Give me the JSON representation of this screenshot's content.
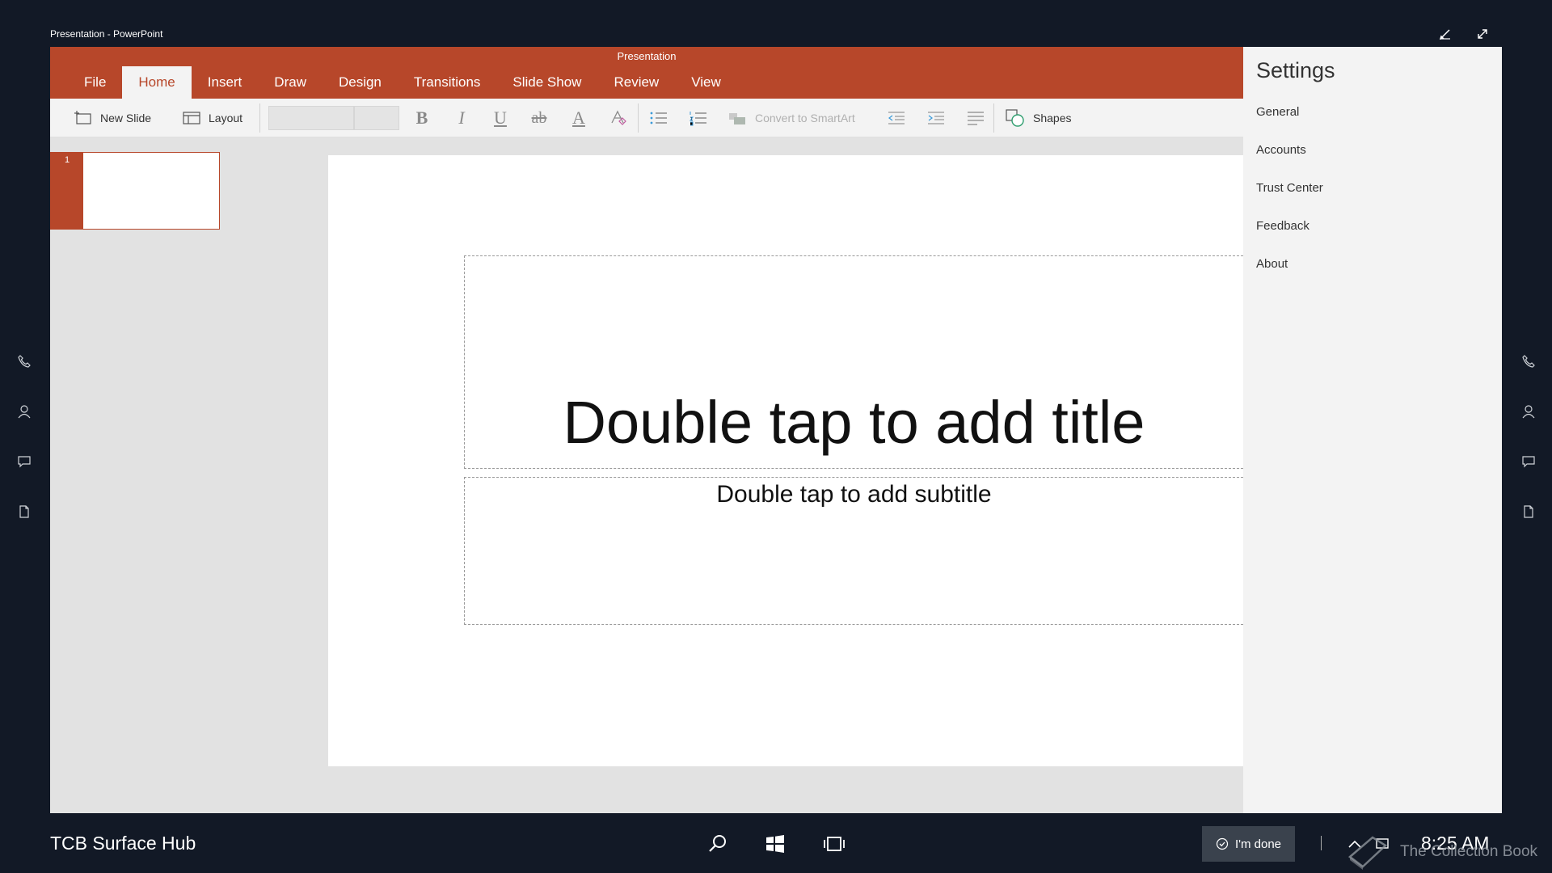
{
  "window": {
    "title": "Presentation - PowerPoint"
  },
  "app": {
    "doc_title": "Presentation",
    "tabs": [
      "File",
      "Home",
      "Insert",
      "Draw",
      "Design",
      "Transitions",
      "Slide Show",
      "Review",
      "View"
    ],
    "active_tab": "Home",
    "toolbar": {
      "new_slide": "New Slide",
      "layout": "Layout",
      "font_name": "",
      "font_size": "",
      "bold": "B",
      "italic": "I",
      "underline": "U",
      "strikethrough": "ab",
      "font_color": "A",
      "convert_smartart": "Convert to SmartArt",
      "shapes": "Shapes"
    },
    "thumbnails": [
      {
        "number": "1"
      }
    ],
    "slide": {
      "title_placeholder": "Double tap to add title",
      "subtitle_placeholder": "Double tap to add subtitle"
    }
  },
  "settings": {
    "title": "Settings",
    "items": [
      "General",
      "Accounts",
      "Trust Center",
      "Feedback",
      "About"
    ]
  },
  "taskbar": {
    "device_name": "TCB Surface Hub",
    "done_label": "I'm done",
    "clock": "8:25 AM",
    "watermark": "The Collection Book"
  },
  "colors": {
    "accent": "#b7472a",
    "background": "#121926",
    "toolbar": "#f3f3f3",
    "canvas": "#e2e2e2"
  }
}
